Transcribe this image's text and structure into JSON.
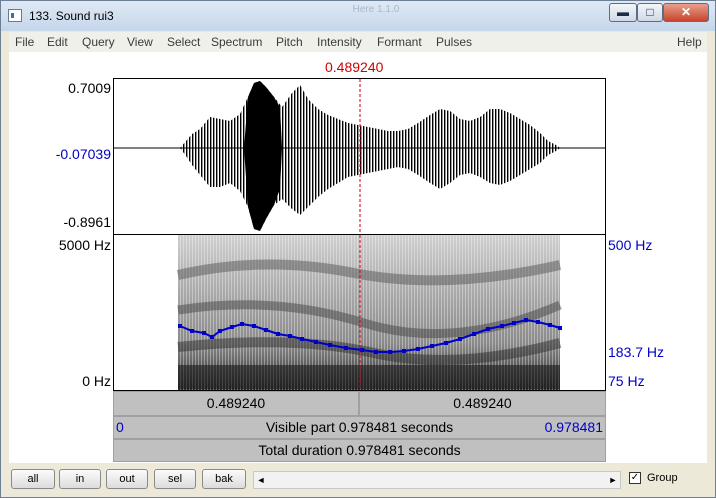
{
  "window": {
    "title": "133. Sound rui3",
    "ghost_title": "Here 1.1.0",
    "controls": {
      "minimize": "▬",
      "maximize": "□",
      "close": "✕"
    }
  },
  "menu": [
    "File",
    "Edit",
    "Query",
    "View",
    "Select",
    "Spectrum",
    "Pitch",
    "Intensity",
    "Formant",
    "Pulses",
    "Help"
  ],
  "cursor": {
    "time": "0.489240"
  },
  "waveform": {
    "max": "0.7009",
    "mid": "-0.07039",
    "min": "-0.8961"
  },
  "spectrogram": {
    "max_freq": "5000 Hz",
    "min_freq": "0 Hz"
  },
  "pitch": {
    "max": "500 Hz",
    "value": "183.7 Hz",
    "min": "75 Hz"
  },
  "bars": {
    "left_time": "0.489240",
    "right_time": "0.489240",
    "visible_start": "0",
    "visible_part": "Visible part 0.978481 seconds",
    "visible_end": "0.978481",
    "total_duration": "Total duration 0.978481 seconds"
  },
  "toolbar": {
    "buttons": [
      "all",
      "in",
      "out",
      "sel",
      "bak"
    ],
    "group_label": "Group",
    "group_checked": "✓",
    "scroll_left": "◄",
    "scroll_right": "►"
  },
  "colors": {
    "cursor": "#d00000",
    "pitch_track": "#0000c8",
    "axis_blue": "#0000c8"
  },
  "icons": {
    "app": "praat-window-icon",
    "checkbox": "check-icon"
  }
}
